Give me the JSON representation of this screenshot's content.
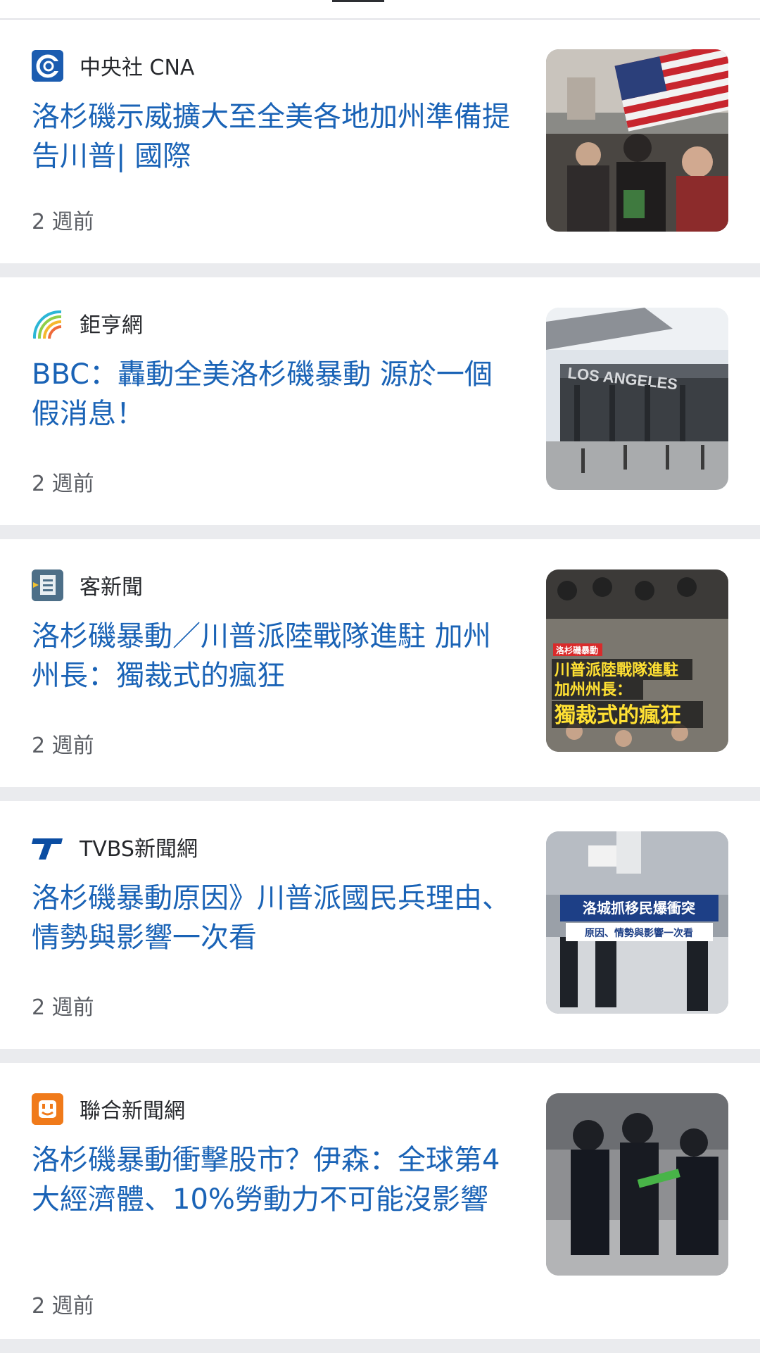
{
  "feed": {
    "items": [
      {
        "source": "中央社 CNA",
        "source_icon": "cna-logo-icon",
        "headline": "洛杉磯示威擴大至全美各地加州準備提告川普| 國際",
        "time": "2 週前",
        "thumbnail": "protest-us-flag-photo"
      },
      {
        "source": "鉅亨網",
        "source_icon": "cnyes-rainbow-logo-icon",
        "headline": "BBC：轟動全美洛杉磯暴動 源於一個假消息！",
        "time": "2 週前",
        "thumbnail": "los-angeles-building-photo"
      },
      {
        "source": "客新聞",
        "source_icon": "hakka-news-logo-icon",
        "headline": "洛杉磯暴動／川普派陸戰隊進駐 加州州長：獨裁式的瘋狂",
        "time": "2 週前",
        "thumbnail": "protest-crowd-photo",
        "thumbnail_text": {
          "tag": "洛杉磯暴動",
          "line1": "川普派陸戰隊進駐",
          "line2": "加州州長：",
          "line3": "獨裁式的瘋狂"
        }
      },
      {
        "source": "TVBS新聞網",
        "source_icon": "tvbs-logo-icon",
        "headline": "洛杉磯暴動原因》川普派國民兵理由、情勢與影響一次看",
        "time": "2 週前",
        "thumbnail": "police-tear-gas-photo",
        "thumbnail_text": {
          "line1": "洛城抓移民爆衝突",
          "line2": "原因、情勢與影響一次看"
        }
      },
      {
        "source": "聯合新聞網",
        "source_icon": "udn-logo-icon",
        "headline": "洛杉磯暴動衝擊股市？伊森：全球第4大經濟體、10%勞動力不可能沒影響",
        "time": "2 週前",
        "thumbnail": "riot-police-photo"
      }
    ]
  },
  "colors": {
    "headline": "#1a63b6",
    "source": "#26282c",
    "time": "#5a5d63",
    "separator": "#eaebee"
  }
}
